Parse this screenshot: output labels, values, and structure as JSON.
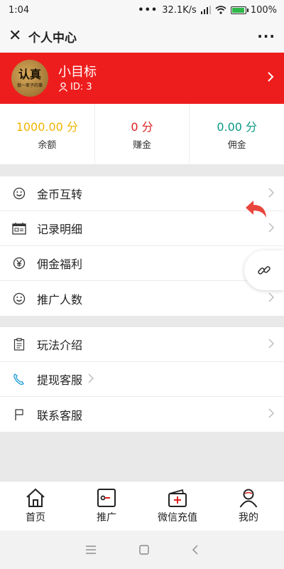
{
  "status": {
    "time": "1:04",
    "network_speed": "32.1K/s",
    "battery": "100%",
    "battery_level": 1.0
  },
  "header": {
    "title": "个人中心"
  },
  "profile": {
    "avatar_text": "认真",
    "avatar_sub": "做一辈子的事",
    "name": "小目标",
    "user_id": "ID: 3"
  },
  "stats": [
    {
      "value": "1000.00",
      "unit": "分",
      "label": "余额",
      "color": "#f0b400"
    },
    {
      "value": "0",
      "unit": "分",
      "label": "赚金",
      "color": "#e02020"
    },
    {
      "value": "0.00",
      "unit": "分",
      "label": "佣金",
      "color": "#0a9a86"
    }
  ],
  "menu1": [
    {
      "label": "金币互转",
      "icon": "smile-icon"
    },
    {
      "label": "记录明细",
      "icon": "calendar-icon"
    },
    {
      "label": "佣金福利",
      "icon": "yen-icon"
    },
    {
      "label": "推广人数",
      "icon": "smile-icon"
    }
  ],
  "menu2": [
    {
      "label": "玩法介绍",
      "icon": "clipboard-icon"
    },
    {
      "label": "提现客服",
      "icon": "phone-icon"
    },
    {
      "label": "联系客服",
      "icon": "flag-icon"
    }
  ],
  "tabbar": [
    {
      "label": "首页",
      "icon": "home-icon"
    },
    {
      "label": "推广",
      "icon": "share-box-icon"
    },
    {
      "label": "微信充值",
      "icon": "wallet-icon"
    },
    {
      "label": "我的",
      "icon": "user-icon"
    }
  ],
  "colors": {
    "accent": "#ee1d1d",
    "undo_arrow": "#e8453c"
  }
}
